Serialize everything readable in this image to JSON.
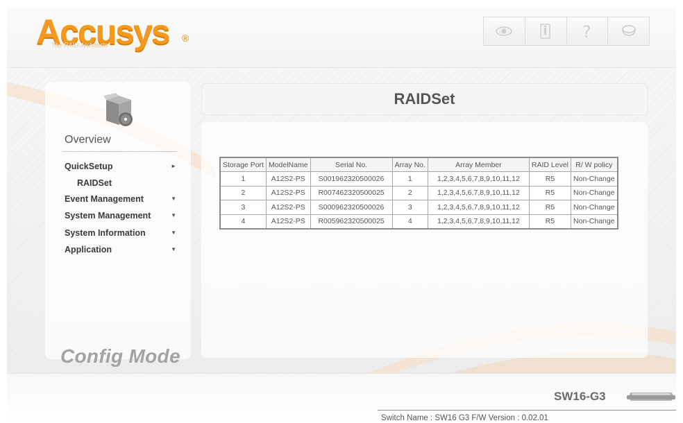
{
  "brand": {
    "logo_text": "Accusys",
    "registered_mark": "®",
    "tagline": "The RAID Architects",
    "accent_color": "#f39a1e"
  },
  "toolbar": {
    "buttons": [
      {
        "icon": "eye-icon"
      },
      {
        "icon": "info-icon"
      },
      {
        "icon": "help-icon"
      },
      {
        "icon": "logout-icon"
      }
    ]
  },
  "sidebar": {
    "overview_label": "Overview",
    "items": [
      {
        "label": "QuickSetup",
        "arrow": "►"
      },
      {
        "label": "RAIDSet"
      },
      {
        "label": "Event Management",
        "arrow": "▼"
      },
      {
        "label": "System Management",
        "arrow": "▼"
      },
      {
        "label": "System Information",
        "arrow": "▼"
      },
      {
        "label": "Application",
        "arrow": "▼"
      }
    ],
    "mode_label": "Config Mode"
  },
  "main": {
    "title": "RAIDSet",
    "table": {
      "headers": [
        "Storage Port",
        "ModelName",
        "Serial No.",
        "Array No.",
        "Array Member",
        "RAID Level",
        "R/ W policy"
      ],
      "rows": [
        [
          "1",
          "A12S2-PS",
          "S001962320500026",
          "1",
          "1,2,3,4,5,6,7,8,9,10,11,12",
          "R5",
          "Non-Change"
        ],
        [
          "2",
          "A12S2-PS",
          "R007462320500025",
          "2",
          "1,2,3,4,5,6,7,8,9,10,11,12",
          "R5",
          "Non-Change"
        ],
        [
          "3",
          "A12S2-PS",
          "S000962320500026",
          "3",
          "1,2,3,4,5,6,7,8,9,10,11,12",
          "R5",
          "Non-Change"
        ],
        [
          "4",
          "A12S2-PS",
          "R005962320500025",
          "4",
          "1,2,3,4,5,6,7,8,9,10,11,12",
          "R5",
          "Non-Change"
        ]
      ]
    }
  },
  "footer": {
    "model": "SW16-G3",
    "switch_info": "Switch Name : SW16 G3 F/W Version : 0.02.01"
  }
}
